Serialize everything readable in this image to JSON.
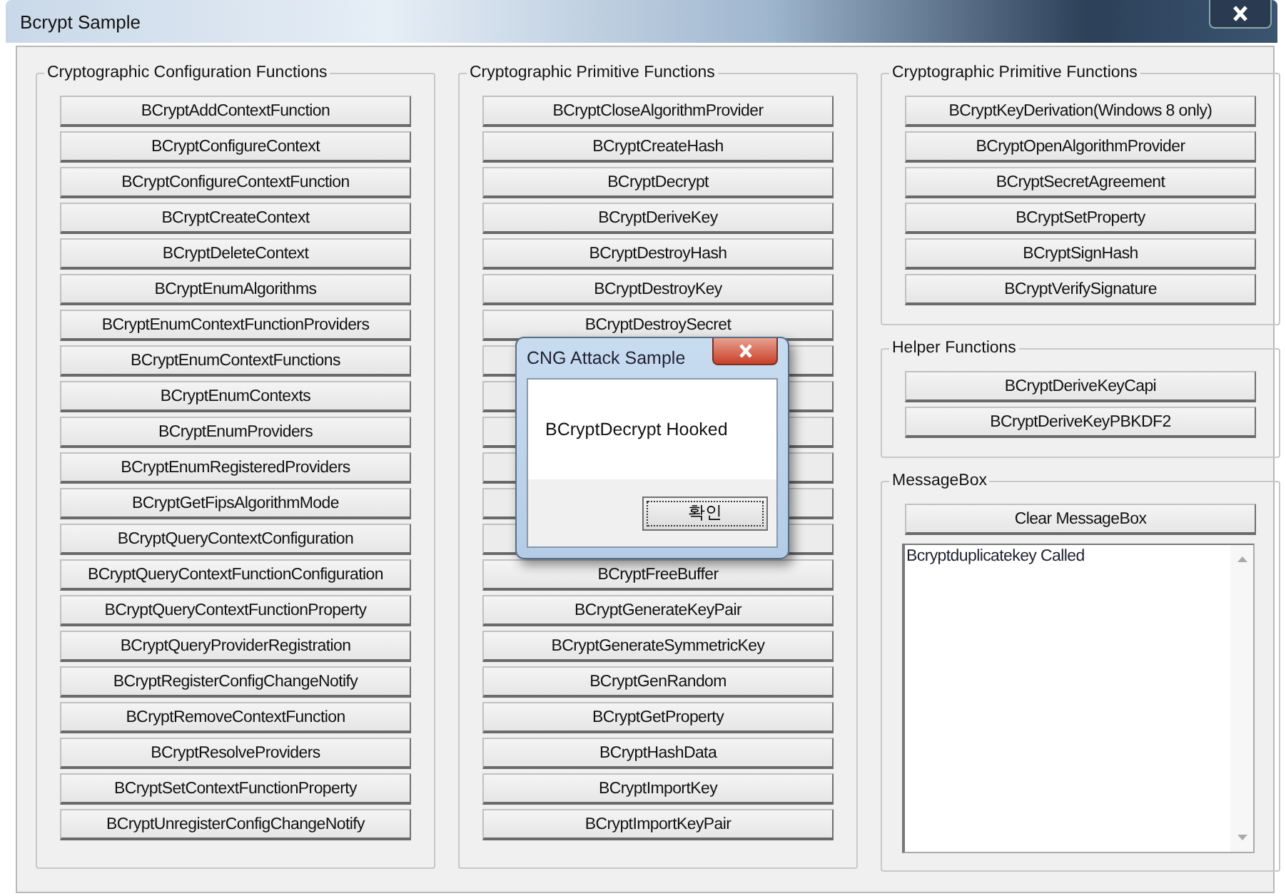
{
  "window": {
    "title": "Bcrypt Sample"
  },
  "groups": [
    {
      "title": "Cryptographic Configuration Functions",
      "buttons": [
        {
          "kind": "button",
          "label": "BCryptAddContextFunction"
        },
        {
          "kind": "button",
          "label": "BCryptConfigureContext"
        },
        {
          "kind": "button",
          "label": "BCryptConfigureContextFunction"
        },
        {
          "kind": "button",
          "label": "BCryptCreateContext"
        },
        {
          "kind": "button",
          "label": "BCryptDeleteContext"
        },
        {
          "kind": "button",
          "label": "BCryptEnumAlgorithms"
        },
        {
          "kind": "button",
          "label": "BCryptEnumContextFunctionProviders"
        },
        {
          "kind": "button",
          "label": "BCryptEnumContextFunctions"
        },
        {
          "kind": "button",
          "label": "BCryptEnumContexts"
        },
        {
          "kind": "button",
          "label": "BCryptEnumProviders"
        },
        {
          "kind": "button",
          "label": "BCryptEnumRegisteredProviders"
        },
        {
          "kind": "button",
          "label": "BCryptGetFipsAlgorithmMode"
        },
        {
          "kind": "button",
          "label": "BCryptQueryContextConfiguration"
        },
        {
          "kind": "button",
          "label": "BCryptQueryContextFunctionConfiguration"
        },
        {
          "kind": "button",
          "label": "BCryptQueryContextFunctionProperty"
        },
        {
          "kind": "button",
          "label": "BCryptQueryProviderRegistration"
        },
        {
          "kind": "button",
          "label": "BCryptRegisterConfigChangeNotify"
        },
        {
          "kind": "button",
          "label": "BCryptRemoveContextFunction"
        },
        {
          "kind": "button",
          "label": "BCryptResolveProviders"
        },
        {
          "kind": "button",
          "label": "BCryptSetContextFunctionProperty"
        },
        {
          "kind": "button",
          "label": "BCryptUnregisterConfigChangeNotify"
        }
      ]
    },
    {
      "title": "Cryptographic Primitive Functions",
      "buttons": [
        {
          "kind": "button",
          "label": "BCryptCloseAlgorithmProvider"
        },
        {
          "kind": "button",
          "label": "BCryptCreateHash"
        },
        {
          "kind": "button",
          "label": "BCryptDecrypt"
        },
        {
          "kind": "button",
          "label": "BCryptDeriveKey"
        },
        {
          "kind": "button",
          "label": "BCryptDestroyHash"
        },
        {
          "kind": "button",
          "label": "BCryptDestroyKey"
        },
        {
          "kind": "button",
          "label": "BCryptDestroySecret"
        },
        {
          "kind": "covered"
        },
        {
          "kind": "covered"
        },
        {
          "kind": "covered"
        },
        {
          "kind": "covered"
        },
        {
          "kind": "covered"
        },
        {
          "kind": "covered"
        },
        {
          "kind": "button",
          "label": "BCryptFreeBuffer"
        },
        {
          "kind": "button",
          "label": "BCryptGenerateKeyPair"
        },
        {
          "kind": "button",
          "label": "BCryptGenerateSymmetricKey"
        },
        {
          "kind": "button",
          "label": "BCryptGenRandom"
        },
        {
          "kind": "button",
          "label": "BCryptGetProperty"
        },
        {
          "kind": "button",
          "label": "BCryptHashData"
        },
        {
          "kind": "button",
          "label": "BCryptImportKey"
        },
        {
          "kind": "button",
          "label": "BCryptImportKeyPair"
        }
      ]
    }
  ],
  "right_groups": [
    {
      "title": "Cryptographic Primitive Functions",
      "buttons": [
        {
          "kind": "button",
          "label": "BCryptKeyDerivation(Windows 8 only)"
        },
        {
          "kind": "button",
          "label": "BCryptOpenAlgorithmProvider"
        },
        {
          "kind": "button",
          "label": "BCryptSecretAgreement"
        },
        {
          "kind": "button",
          "label": "BCryptSetProperty"
        },
        {
          "kind": "button",
          "label": "BCryptSignHash"
        },
        {
          "kind": "button",
          "label": "BCryptVerifySignature"
        }
      ]
    },
    {
      "title": "Helper Functions",
      "buttons": [
        {
          "kind": "button",
          "label": "BCryptDeriveKeyCapi"
        },
        {
          "kind": "button",
          "label": "BCryptDeriveKeyPBKDF2"
        }
      ]
    }
  ],
  "message_box": {
    "title": "MessageBox",
    "clear_button": "Clear MessageBox",
    "log": [
      "Bcryptduplicatekey Called"
    ]
  },
  "dialog": {
    "title": "CNG Attack Sample",
    "message": "BCryptDecrypt Hooked",
    "ok_button": "확인"
  }
}
